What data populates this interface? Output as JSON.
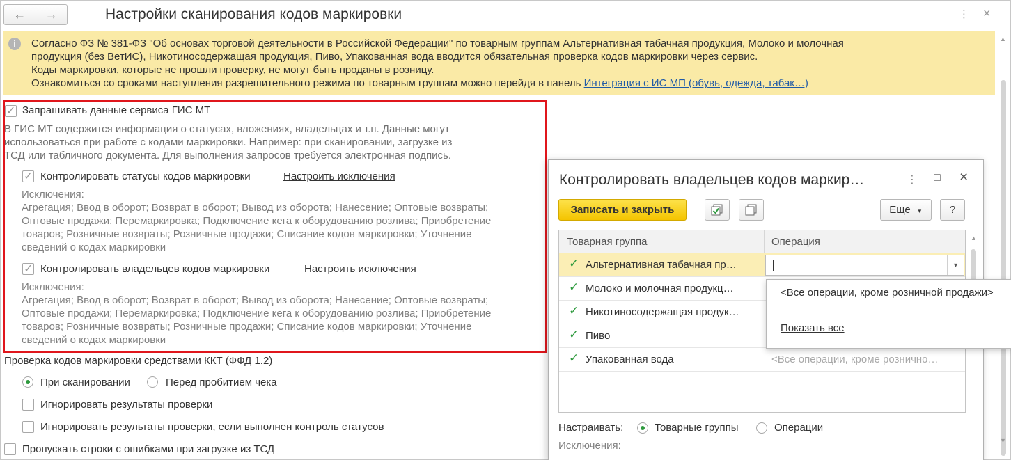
{
  "header": {
    "title": "Настройки сканирования кодов маркировки",
    "back_icon": "←",
    "forward_icon": "→",
    "more_icon": "⋮",
    "close_icon": "×"
  },
  "banner": {
    "icon": "i",
    "lines": [
      "Согласно ФЗ № 381-ФЗ \"Об основах торговой деятельности в Российской Федерации\" по товарным группам Альтернативная табачная продукция, Молоко и молочная",
      "продукция (без ВетИС), Никотиносодержащая продукция, Пиво, Упакованная вода вводится обязательная проверка кодов маркировки через сервис.",
      "Коды маркировки, которые не прошли проверку, не могут быть проданы в розницу."
    ],
    "last_line_text": "Ознакомиться со сроками наступления разрешительного режима по товарным группам можно перейдя в панель ",
    "last_line_link": "Интеграция с ИС МП (обувь, одежда, табак…)"
  },
  "gis": {
    "request_label": "Запрашивать данные сервиса ГИС МТ",
    "description": [
      "В ГИС МТ содержится информация о статусах, вложениях, владельцах и т.п. Данные могут",
      "использоваться при работе с кодами маркировки. Например: при сканировании, загрузке из",
      "ТСД или табличного документа. Для выполнения запросов требуется электронная подпись."
    ],
    "status_label": "Контролировать статусы кодов маркировки",
    "status_link": "Настроить исключения",
    "status_exceptions": [
      "Исключения:",
      "Агрегация; Ввод в оборот; Возврат в оборот; Вывод из оборота; Нанесение; Оптовые возвраты;",
      "Оптовые продажи; Перемаркировка; Подключение кега к оборудованию розлива; Приобретение",
      "товаров; Розничные возвраты; Розничные продажи; Списание кодов маркировки; Уточнение",
      "сведений о кодах маркировки"
    ],
    "owners_label": "Контролировать владельцев кодов маркировки",
    "owners_link": "Настроить исключения",
    "owners_exceptions": [
      "Исключения:",
      "Агрегация; Ввод в оборот; Возврат в оборот; Вывод из оборота; Нанесение; Оптовые возвраты;",
      "Оптовые продажи; Перемаркировка; Подключение кега к оборудованию розлива; Приобретение",
      "товаров; Розничные возвраты; Розничные продажи; Списание кодов маркировки; Уточнение",
      "сведений о кодах маркировки"
    ]
  },
  "kkt": {
    "title": "Проверка кодов маркировки средствами ККТ (ФФД 1.2)",
    "radio_scan": "При сканировании",
    "radio_before": "Перед пробитием чека",
    "ignore_results": "Игнорировать результаты проверки",
    "ignore_if_status": "Игнорировать результаты проверки, если выполнен контроль статусов",
    "skip_rows": "Пропускать строки с ошибками при загрузке из ТСД"
  },
  "dialog": {
    "title": "Контролировать владельцев кодов маркир…",
    "more_icon": "⋮",
    "maximize_icon": "□",
    "close_icon": "×",
    "save_close": "Записать и закрыть",
    "more_btn": "Еще",
    "help_btn": "?",
    "columns": [
      "Товарная группа",
      "Операция"
    ],
    "rows": [
      {
        "name": "Альтернативная табачная пр…",
        "op": ""
      },
      {
        "name": "Молоко и молочная продукц…",
        "op": ""
      },
      {
        "name": "Никотиносодержащая продук…",
        "op": ""
      },
      {
        "name": "Пиво",
        "op": ""
      },
      {
        "name": "Упакованная вода",
        "op": "<Все операции, кроме рознично…"
      }
    ],
    "configure_label": "Настраивать:",
    "radio_groups": "Товарные группы",
    "radio_operations": "Операции",
    "exceptions_label": "Исключения:"
  },
  "popup": {
    "option_all": "<Все операции, кроме розничной продажи>",
    "show_all": "Показать все"
  }
}
